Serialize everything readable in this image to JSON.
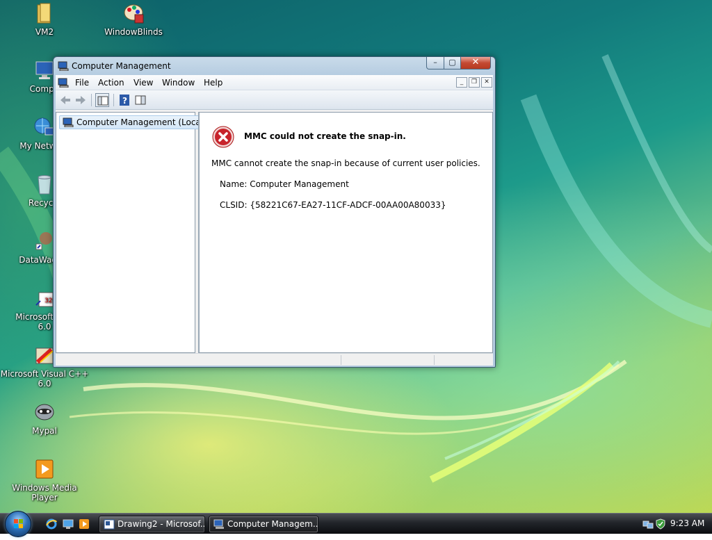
{
  "desktop": {
    "icons": [
      {
        "label": "VM2",
        "icon": "folder-icon"
      },
      {
        "label": "WindowBlinds",
        "icon": "palette-icon"
      },
      {
        "label": "Compu",
        "icon": "computer-icon"
      },
      {
        "label": "My Network",
        "icon": "network-icon"
      },
      {
        "label": "Recycle",
        "icon": "recycle-bin-icon"
      },
      {
        "label": "DataWagon.",
        "icon": "datawagon-icon"
      },
      {
        "label": "Microsoft Visu",
        "label2": "6.0",
        "icon": "visual-studio-icon"
      },
      {
        "label": "Microsoft Visual C++",
        "label2": "6.0",
        "icon": "visual-cpp-icon"
      },
      {
        "label": "Mypal",
        "icon": "mypal-icon"
      },
      {
        "label": "Windows Media Player",
        "icon": "media-player-icon"
      }
    ]
  },
  "window": {
    "title": "Computer Management",
    "caption_buttons": {
      "minimize": "–",
      "maximize": "▢",
      "close": "✕"
    },
    "menu": [
      "File",
      "Action",
      "View",
      "Window",
      "Help"
    ],
    "mdi_buttons": {
      "minimize": "_",
      "restore": "❐",
      "close": "✕"
    },
    "toolbar": [
      "back-icon",
      "forward-icon",
      "show-hide-tree-icon",
      "help-icon",
      "action-pane-icon"
    ],
    "tree": {
      "root_label": "Computer Management (Local)"
    },
    "error": {
      "title": "MMC could not create the snap-in.",
      "description": "MMC cannot create the snap-in because of current user policies.",
      "name_line": "Name: Computer Management",
      "clsid_line": "CLSID: {58221C67-EA27-11CF-ADCF-00AA00A80033}"
    }
  },
  "taskbar": {
    "quick_launch": [
      "ie-icon",
      "show-desktop-icon",
      "media-player-icon"
    ],
    "tasks": [
      {
        "label": "Drawing2 - Microsof...",
        "active": false
      },
      {
        "label": "Computer Managem...",
        "active": true
      }
    ],
    "clock": "9:23 AM"
  },
  "colors": {
    "error_red": "#c8242c",
    "title_bar": "#b4cbe0",
    "selection": "#d3e6f7"
  }
}
